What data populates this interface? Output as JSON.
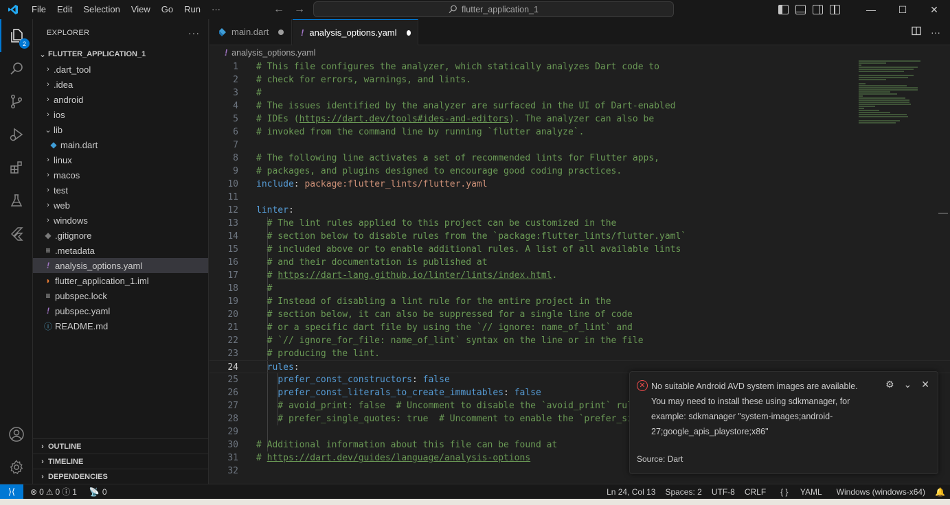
{
  "titlebar": {
    "menu": [
      "File",
      "Edit",
      "Selection",
      "View",
      "Go",
      "Run",
      "···"
    ],
    "search": "flutter_application_1",
    "controls": [
      "—",
      "☐",
      "✕"
    ]
  },
  "activity": {
    "explorer_badge": "2"
  },
  "sidebar": {
    "header": "EXPLORER",
    "more": "···",
    "folder": "FLUTTER_APPLICATION_1",
    "items": [
      {
        "label": ".dart_tool",
        "kind": "folder",
        "open": false,
        "depth": 0
      },
      {
        "label": ".idea",
        "kind": "folder",
        "open": false,
        "depth": 0
      },
      {
        "label": "android",
        "kind": "folder",
        "open": false,
        "depth": 0
      },
      {
        "label": "ios",
        "kind": "folder",
        "open": false,
        "depth": 0
      },
      {
        "label": "lib",
        "kind": "folder",
        "open": true,
        "depth": 0
      },
      {
        "label": "main.dart",
        "kind": "dart",
        "depth": 1
      },
      {
        "label": "linux",
        "kind": "folder",
        "open": false,
        "depth": 0
      },
      {
        "label": "macos",
        "kind": "folder",
        "open": false,
        "depth": 0
      },
      {
        "label": "test",
        "kind": "folder",
        "open": false,
        "depth": 0
      },
      {
        "label": "web",
        "kind": "folder",
        "open": false,
        "depth": 0
      },
      {
        "label": "windows",
        "kind": "folder",
        "open": false,
        "depth": 0
      },
      {
        "label": ".gitignore",
        "kind": "git",
        "depth": 0
      },
      {
        "label": ".metadata",
        "kind": "lines",
        "depth": 0
      },
      {
        "label": "analysis_options.yaml",
        "kind": "yaml",
        "depth": 0,
        "selected": true
      },
      {
        "label": "flutter_application_1.iml",
        "kind": "rss",
        "depth": 0
      },
      {
        "label": "pubspec.lock",
        "kind": "lines",
        "depth": 0
      },
      {
        "label": "pubspec.yaml",
        "kind": "yaml",
        "depth": 0
      },
      {
        "label": "README.md",
        "kind": "info",
        "depth": 0
      }
    ],
    "sections": [
      "OUTLINE",
      "TIMELINE",
      "DEPENDENCIES"
    ]
  },
  "tabs": [
    {
      "label": "main.dart",
      "active": false
    },
    {
      "label": "analysis_options.yaml",
      "active": true
    }
  ],
  "breadcrumb": "analysis_options.yaml",
  "code": [
    {
      "n": "1",
      "parts": [
        [
          "cm",
          "# This file configures the analyzer, which statically analyzes Dart code to"
        ]
      ]
    },
    {
      "n": "2",
      "parts": [
        [
          "cm",
          "# check for errors, warnings, and lints."
        ]
      ]
    },
    {
      "n": "3",
      "parts": [
        [
          "cm",
          "#"
        ]
      ]
    },
    {
      "n": "4",
      "parts": [
        [
          "cm",
          "# The issues identified by the analyzer are surfaced in the UI of Dart-enabled"
        ]
      ]
    },
    {
      "n": "5",
      "parts": [
        [
          "cm",
          "# IDEs ("
        ],
        [
          "cm u",
          "https://dart.dev/tools#ides-and-editors"
        ],
        [
          "cm",
          "). The analyzer can also be"
        ]
      ]
    },
    {
      "n": "6",
      "parts": [
        [
          "cm",
          "# invoked from the command line by running `flutter analyze`."
        ]
      ]
    },
    {
      "n": "7",
      "parts": []
    },
    {
      "n": "8",
      "parts": [
        [
          "cm",
          "# The following line activates a set of recommended lints for Flutter apps,"
        ]
      ]
    },
    {
      "n": "9",
      "parts": [
        [
          "cm",
          "# packages, and plugins designed to encourage good coding practices."
        ]
      ]
    },
    {
      "n": "10",
      "parts": [
        [
          "key",
          "include"
        ],
        [
          "punc",
          ": "
        ],
        [
          "str",
          "package:flutter_lints/flutter.yaml"
        ]
      ]
    },
    {
      "n": "11",
      "parts": []
    },
    {
      "n": "12",
      "parts": [
        [
          "key",
          "linter"
        ],
        [
          "punc",
          ":"
        ]
      ]
    },
    {
      "n": "13",
      "parts": [
        [
          "cm",
          "  # The lint rules applied to this project can be customized in the"
        ]
      ]
    },
    {
      "n": "14",
      "parts": [
        [
          "cm",
          "  # section below to disable rules from the `package:flutter_lints/flutter.yaml`"
        ]
      ]
    },
    {
      "n": "15",
      "parts": [
        [
          "cm",
          "  # included above or to enable additional rules. A list of all available lints"
        ]
      ]
    },
    {
      "n": "16",
      "parts": [
        [
          "cm",
          "  # and their documentation is published at"
        ]
      ]
    },
    {
      "n": "17",
      "parts": [
        [
          "cm",
          "  # "
        ],
        [
          "cm u",
          "https://dart-lang.github.io/linter/lints/index.html"
        ],
        [
          "cm",
          "."
        ]
      ]
    },
    {
      "n": "18",
      "parts": [
        [
          "cm",
          "  #"
        ]
      ]
    },
    {
      "n": "19",
      "parts": [
        [
          "cm",
          "  # Instead of disabling a lint rule for the entire project in the"
        ]
      ]
    },
    {
      "n": "20",
      "parts": [
        [
          "cm",
          "  # section below, it can also be suppressed for a single line of code"
        ]
      ]
    },
    {
      "n": "21",
      "parts": [
        [
          "cm",
          "  # or a specific dart file by using the `// ignore: name_of_lint` and"
        ]
      ]
    },
    {
      "n": "22",
      "parts": [
        [
          "cm",
          "  # `// ignore_for_file: name_of_lint` syntax on the line or in the file"
        ]
      ]
    },
    {
      "n": "23",
      "parts": [
        [
          "cm",
          "  # producing the lint."
        ]
      ]
    },
    {
      "n": "24",
      "parts": [
        [
          "punc",
          "  "
        ],
        [
          "key",
          "rules"
        ],
        [
          "punc",
          ":"
        ]
      ],
      "current": true
    },
    {
      "n": "25",
      "parts": [
        [
          "punc",
          "    "
        ],
        [
          "key",
          "prefer_const_constructors"
        ],
        [
          "punc",
          ": "
        ],
        [
          "key",
          "false"
        ]
      ]
    },
    {
      "n": "26",
      "parts": [
        [
          "punc",
          "    "
        ],
        [
          "key",
          "prefer_const_literals_to_create_immutables"
        ],
        [
          "punc",
          ": "
        ],
        [
          "key",
          "false"
        ]
      ]
    },
    {
      "n": "27",
      "parts": [
        [
          "cm",
          "    # avoid_print: false  # Uncomment to disable the `avoid_print` rule"
        ]
      ]
    },
    {
      "n": "28",
      "parts": [
        [
          "cm",
          "    # prefer_single_quotes: true  # Uncomment to enable the `prefer_sin"
        ]
      ]
    },
    {
      "n": "29",
      "parts": []
    },
    {
      "n": "30",
      "parts": [
        [
          "cm",
          "# Additional information about this file can be found at"
        ]
      ]
    },
    {
      "n": "31",
      "parts": [
        [
          "cm",
          "# "
        ],
        [
          "cm u",
          "https://dart.dev/guides/language/analysis-options"
        ]
      ]
    },
    {
      "n": "32",
      "parts": []
    }
  ],
  "notification": {
    "lines": [
      "No suitable Android AVD system images are available.",
      "You may need to install these using sdkmanager, for",
      "example: sdkmanager \"system-images;android-",
      "27;google_apis_playstore;x86\""
    ],
    "source": "Source: Dart"
  },
  "status": {
    "errors": "0",
    "warnings": "0",
    "info": "1",
    "ports": "0",
    "position": "Ln 24, Col 13",
    "spaces": "Spaces: 2",
    "encoding": "UTF-8",
    "eol": "CRLF",
    "language": "YAML",
    "device": "Windows (windows-x64)"
  },
  "colors": {
    "accent": "#0078d4",
    "comment": "#6a9955",
    "keyword": "#569cd6",
    "string": "#ce9178",
    "error": "#f14c4c"
  }
}
